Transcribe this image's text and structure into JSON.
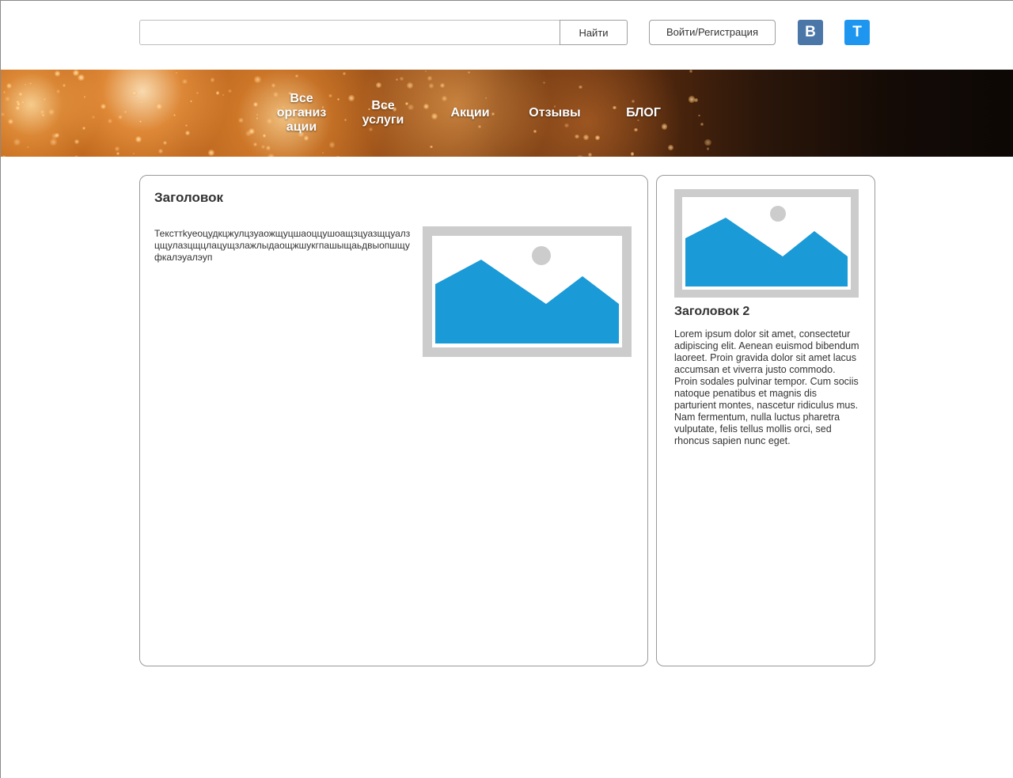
{
  "header": {
    "search": {
      "value": "",
      "placeholder": ""
    },
    "search_button": "Найти",
    "login_button": "Войти/Регистрация",
    "social": [
      {
        "name": "vk-icon",
        "glyph": "B",
        "color": "#4a76a8"
      },
      {
        "name": "telegram-icon",
        "glyph": "T",
        "color": "#1e96f0"
      }
    ]
  },
  "nav": {
    "items": [
      {
        "label": "Все организ ации"
      },
      {
        "label": "Все услуги"
      },
      {
        "label": "Акции"
      },
      {
        "label": "Отзывы"
      },
      {
        "label": "БЛОГ"
      }
    ]
  },
  "main": {
    "title": "Заголовок",
    "text": "Тексттkyеоцудкцжулцзуаожщуцшаоццушоащзцуазщцуалзцщулазцщцлацущзлажлыдаощжшукгпашыщаьдвыопшщуфкалэуалэуп",
    "image_icon": "image-placeholder-icon"
  },
  "sidebar": {
    "title": "Заголовок 2",
    "text": "Lorem ipsum dolor sit amet, consectetur adipiscing elit. Aenean euismod bibendum laoreet. Proin gravida dolor sit amet lacus accumsan et viverra justo commodo. Proin sodales pulvinar tempor. Cum sociis natoque penatibus et magnis dis parturient montes, nascetur ridiculus mus. Nam fermentum, nulla luctus pharetra vulputate, felis tellus mollis orci, sed rhoncus sapien nunc eget.",
    "image_icon": "image-placeholder-icon"
  },
  "colors": {
    "placeholder_frame": "#cccccc",
    "placeholder_mountain": "#1a9ad6",
    "placeholder_sun": "#cccccc"
  }
}
